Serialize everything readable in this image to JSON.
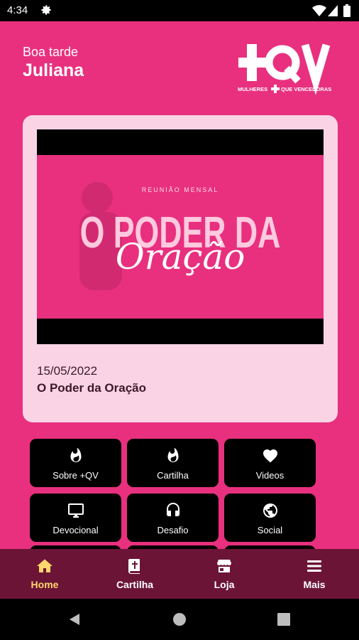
{
  "status_bar": {
    "time": "4:34"
  },
  "greeting": {
    "salutation": "Boa tarde",
    "name": "Juliana"
  },
  "logo": {
    "text": "+QV",
    "tagline": "MULHERES + QUE VENCEDORAS"
  },
  "featured": {
    "thumbnail": {
      "kicker": "REUNIÃO MENSAL",
      "headline": "O PODER DA",
      "script_word": "Oração"
    },
    "date": "15/05/2022",
    "title": "O Poder da Oração"
  },
  "grid": [
    {
      "label": "Sobre +QV",
      "icon": "flame-icon"
    },
    {
      "label": "Cartilha",
      "icon": "flame-icon"
    },
    {
      "label": "Videos",
      "icon": "heart-icon"
    },
    {
      "label": "Devocional",
      "icon": "monitor-icon"
    },
    {
      "label": "Desafio",
      "icon": "headphones-icon"
    },
    {
      "label": "Social",
      "icon": "globe-icon"
    }
  ],
  "bottom_nav": [
    {
      "label": "Home",
      "icon": "home-icon",
      "active": true
    },
    {
      "label": "Cartilha",
      "icon": "bible-icon",
      "active": false
    },
    {
      "label": "Loja",
      "icon": "store-icon",
      "active": false
    },
    {
      "label": "Mais",
      "icon": "menu-icon",
      "active": false
    }
  ],
  "colors": {
    "primary": "#e8307f",
    "card": "#fad4e5",
    "nav_bg": "#6c1436",
    "active": "#ffd66b"
  }
}
